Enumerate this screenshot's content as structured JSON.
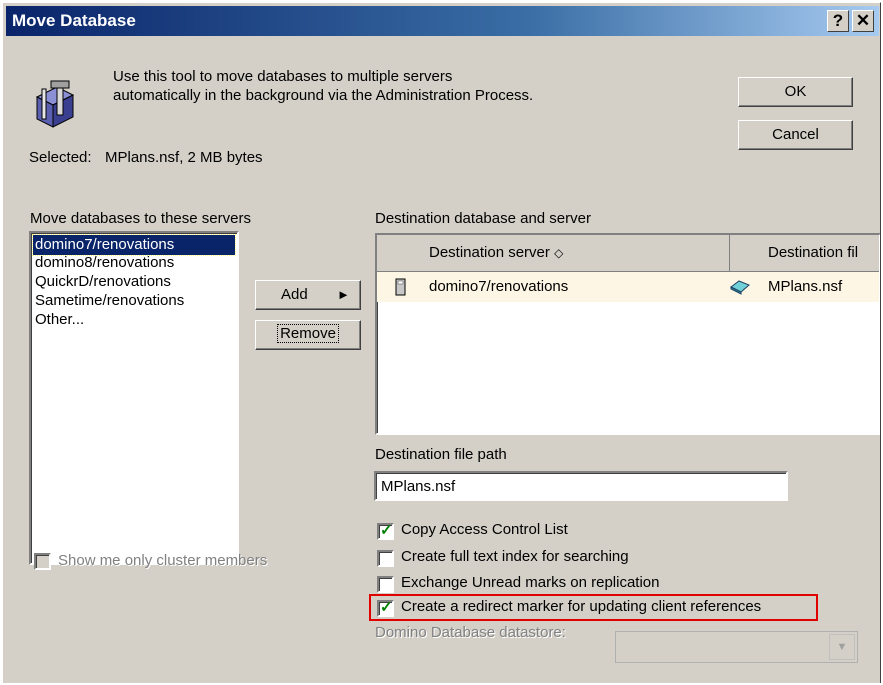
{
  "window": {
    "title": "Move Database",
    "help_label": "?",
    "close_label": "✕"
  },
  "intro": {
    "line1": "Use this tool to move databases to multiple servers",
    "line2": "automatically in the background via the Administration Process."
  },
  "buttons": {
    "ok": "OK",
    "cancel": "Cancel",
    "add": "Add",
    "remove": "Remove"
  },
  "selected": {
    "label": "Selected:",
    "value": "MPlans.nsf, 2 MB bytes"
  },
  "servers_list": {
    "label": "Move databases to these servers",
    "items": [
      "domino7/renovations",
      "domino8/renovations",
      "QuickrD/renovations",
      "Sametime/renovations",
      "Other..."
    ],
    "selected_index": 0
  },
  "destination": {
    "label": "Destination database and server",
    "columns": [
      "Destination server",
      "Destination fil"
    ],
    "rows": [
      {
        "server": "domino7/renovations",
        "file": "MPlans.nsf"
      }
    ]
  },
  "file_path": {
    "label": "Destination file path",
    "value": "MPlans.nsf"
  },
  "options": [
    {
      "label": "Copy Access Control List",
      "checked": true
    },
    {
      "label": "Create full text index for searching",
      "checked": false
    },
    {
      "label": "Exchange Unread marks on replication",
      "checked": false
    },
    {
      "label": "Create a redirect marker for updating client references",
      "checked": true
    }
  ],
  "cluster_only": {
    "label": "Show me only cluster members",
    "checked": false,
    "enabled": false
  },
  "datastore": {
    "label": "Domino Database datastore:",
    "value": "",
    "enabled": false
  },
  "colors": {
    "title_start": "#0a246a",
    "title_end": "#a6caf0",
    "selection": "#0a246a",
    "highlight_box": "#e00000",
    "row_bg": "#fdf6e4"
  }
}
